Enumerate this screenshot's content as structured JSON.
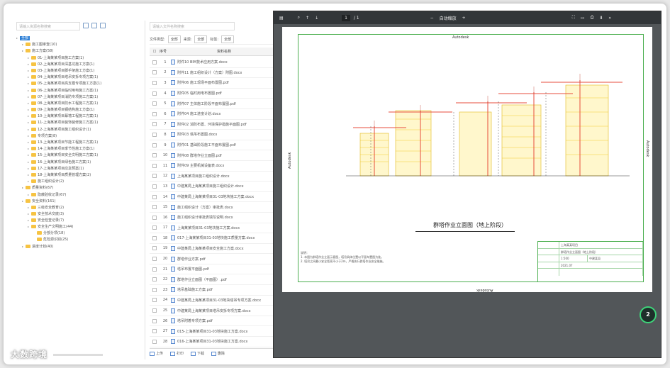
{
  "tree": {
    "search_placeholder": "请输入资源名称搜索",
    "items": [
      {
        "label": "全部",
        "level": 0,
        "selected": true
      },
      {
        "label": "施工图审查(10)",
        "level": 1
      },
      {
        "label": "施工方案(58)",
        "level": 1
      },
      {
        "label": "01-上海某某项目施工方案(1)",
        "level": 2
      },
      {
        "label": "02-上海某某项目深基坑施工方案(1)",
        "level": 2
      },
      {
        "label": "03-上海某某项目脚手架施工方案(1)",
        "level": 2
      },
      {
        "label": "04-上海某某项目塔吊安拆专项方案(1)",
        "level": 2
      },
      {
        "label": "05-上海某某项目高支模专项施工方案(1)",
        "level": 2
      },
      {
        "label": "06-上海某某项目临时用电施工方案(1)",
        "level": 2
      },
      {
        "label": "07-上海某某项目消防专项施工方案(1)",
        "level": 2
      },
      {
        "label": "08-上海某某项目防水工程施工方案(1)",
        "level": 2
      },
      {
        "label": "09-上海某某项目钢结构施工方案(1)",
        "level": 2
      },
      {
        "label": "10-上海某某项目幕墙工程施工方案(1)",
        "level": 2
      },
      {
        "label": "11-上海某某项目装饰装修施工方案(1)",
        "level": 2
      },
      {
        "label": "12-上海某某项目施工组织设计(1)",
        "level": 2
      },
      {
        "label": "专项方案(8)",
        "level": 2
      },
      {
        "label": "13-上海某某项目节能工程施工方案(1)",
        "level": 2
      },
      {
        "label": "14-上海某某项目季节性施工方案(1)",
        "level": 2
      },
      {
        "label": "15-上海某某项目安全文明施工方案(1)",
        "level": 2
      },
      {
        "label": "16-上海某某项目绿色施工方案(1)",
        "level": 2
      },
      {
        "label": "17-上海某某项目应急预案(1)",
        "level": 2
      },
      {
        "label": "18-上海某某项目质量管理方案(2)",
        "level": 2
      },
      {
        "label": "施工组织设计(2)",
        "level": 2
      },
      {
        "label": "质量资料(67)",
        "level": 1
      },
      {
        "label": "隐蔽验收记录(67)",
        "level": 2
      },
      {
        "label": "安全资料(161)",
        "level": 1
      },
      {
        "label": "三级安全教育(2)",
        "level": 2
      },
      {
        "label": "安全技术交底(3)",
        "level": 2
      },
      {
        "label": "安全检查记录(7)",
        "level": 2
      },
      {
        "label": "安全生产文明施工(44)",
        "level": 2
      },
      {
        "label": "分部分项(18)",
        "level": 3
      },
      {
        "label": "危险源识别(25)",
        "level": 3
      },
      {
        "label": "进度计划(40)",
        "level": 1
      }
    ]
  },
  "list": {
    "search_placeholder": "请输入文件名称搜索",
    "filter_type_label": "文件类型:",
    "filter_type_value": "全部",
    "filter_source_label": "来源:",
    "filter_source_value": "全部",
    "filter_tag_label": "标签:",
    "filter_tag_value": "全部",
    "col_index": "序号",
    "col_name": "资料名称",
    "rows": [
      {
        "num": "1",
        "name": "附件10 BIM技术应用方案.docx"
      },
      {
        "num": "2",
        "name": "附件11 施工组织设计（方案）附图.docx"
      },
      {
        "num": "3",
        "name": "附件06 施工现场平面布置图.pdf"
      },
      {
        "num": "4",
        "name": "附件05 临时用电布置图.pdf"
      },
      {
        "num": "5",
        "name": "附件07 主体施工阶段平面布置图.pdf"
      },
      {
        "num": "6",
        "name": "附件04 施工进度计划.docx"
      },
      {
        "num": "7",
        "name": "附件02 消防布置、环境保护措施平面图.pdf"
      },
      {
        "num": "8",
        "name": "附件03 塔吊布置图.docx"
      },
      {
        "num": "9",
        "name": "附件01 基础阶段施工平面布置图.pdf"
      },
      {
        "num": "10",
        "name": "附件08 群塔作业立面图.pdf"
      },
      {
        "num": "11",
        "name": "附件09 主要机械设备表.docx"
      },
      {
        "num": "12",
        "name": "上海某某项目施工组织设计.docx"
      },
      {
        "num": "13",
        "name": "中建某局上海某某项目施工组织设计.docx"
      },
      {
        "num": "14",
        "name": "中建某局上海某某项目31-03地块施工方案.docx"
      },
      {
        "num": "15",
        "name": "施工组织设计（方案）审批表.docx"
      },
      {
        "num": "16",
        "name": "施工组织设计审批表填写说明.docx"
      },
      {
        "num": "17",
        "name": "上海某某项目31-03地块施工方案.docx"
      },
      {
        "num": "18",
        "name": "017-上海某某项目31-03地块施工质量方案.docx"
      },
      {
        "num": "19",
        "name": "中建某局上海某某项目安全施工方案.docx"
      },
      {
        "num": "20",
        "name": "群塔作业方案.pdf"
      },
      {
        "num": "21",
        "name": "塔吊布置平面图.pdf"
      },
      {
        "num": "22",
        "name": "群塔作业立面图（平面图）.pdf"
      },
      {
        "num": "23",
        "name": "塔吊基础施工方案.pdf"
      },
      {
        "num": "24",
        "name": "中建某局上海某某项目31-03地块塔吊专项方案.docx"
      },
      {
        "num": "25",
        "name": "中建某局上海某某项目塔吊安拆专项方案.docx"
      },
      {
        "num": "26",
        "name": "塔吊附着专项方案.pdf"
      },
      {
        "num": "27",
        "name": "015-上海某某项目31-03地块施工方案.docx"
      },
      {
        "num": "28",
        "name": "016-上海某某项目31-03地块施工方案.docx"
      }
    ],
    "footer_upload": "上传",
    "footer_print": "打印",
    "footer_download": "下载",
    "footer_delete": "删除"
  },
  "viewer": {
    "page_current": "1",
    "page_total": "/ 1",
    "zoom": "自动缩放",
    "autodesk": "Autodesk",
    "drawing_title": "群塔作业立面图（地上阶段）",
    "notes_title": "说明：",
    "notes_1": "1. 本图为群塔作业立面示意图，塔吊具体位置以平面布置图为准。",
    "notes_2": "2. 塔吊之间最小安全距离不小于2m，严格执行群塔作业安全措施。",
    "tb_project": "上海某某项目",
    "tb_drawing": "群塔作业立面图（地上阶段）",
    "tb_scale": "1:500",
    "tb_date": "2021.07",
    "tb_company": "中建某局",
    "page_badge": "2"
  },
  "watermark": "大数跨境",
  "colors": {
    "selected": "#2d7fd6",
    "folder": "#f6c343",
    "viewer_bg": "#525659",
    "toolbar": "#323639",
    "sheet_border": "#4caf50",
    "crane": "#e74c3c",
    "building": "#f1c40f"
  }
}
